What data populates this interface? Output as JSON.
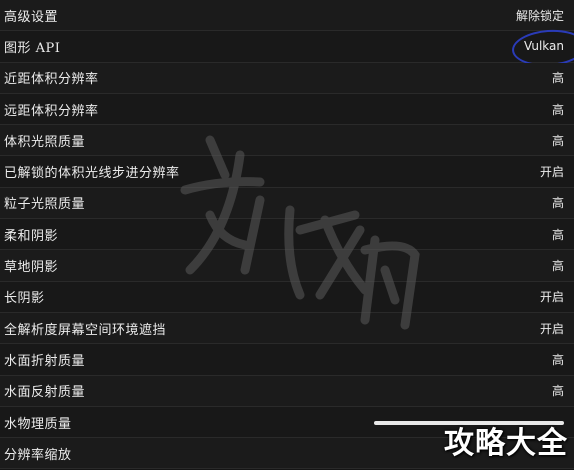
{
  "settings": {
    "rows": [
      {
        "label": "高级设置",
        "value": "解除锁定"
      },
      {
        "label": "图形 API",
        "value": "Vulkan"
      },
      {
        "label": "近距体积分辨率",
        "value": "高"
      },
      {
        "label": "远距体积分辨率",
        "value": "高"
      },
      {
        "label": "体积光照质量",
        "value": "高"
      },
      {
        "label": "已解锁的体积光线步进分辨率",
        "value": "开启"
      },
      {
        "label": "粒子光照质量",
        "value": "高"
      },
      {
        "label": "柔和阴影",
        "value": "高"
      },
      {
        "label": "草地阴影",
        "value": "高"
      },
      {
        "label": "长阴影",
        "value": "开启"
      },
      {
        "label": "全解析度屏幕空间环境遮挡",
        "value": "开启"
      },
      {
        "label": "水面折射质量",
        "value": "高"
      },
      {
        "label": "水面反射质量",
        "value": "高"
      },
      {
        "label": "水物理质量",
        "value": ""
      },
      {
        "label": "分辨率缩放",
        "value": ""
      }
    ],
    "water_physics_slider_fraction": 1.0
  },
  "watermark": {
    "corner_text": "攻略大全"
  },
  "colors": {
    "background": "#151515",
    "text": "#ececec",
    "annotation_circle": "#2a3bb8"
  }
}
